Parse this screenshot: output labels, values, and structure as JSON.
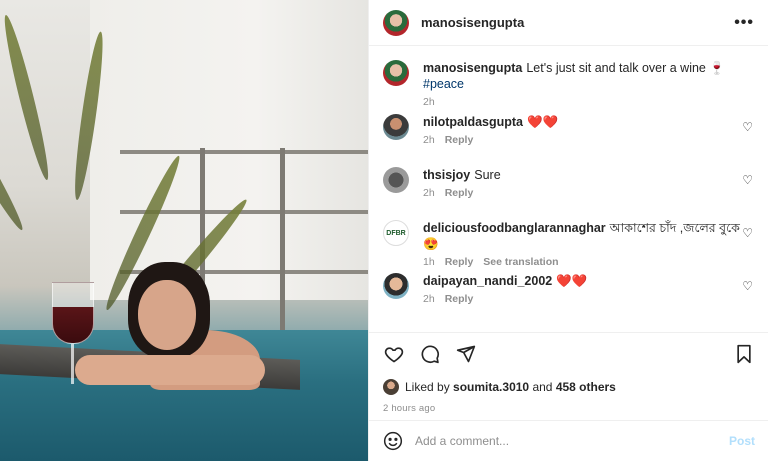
{
  "post": {
    "username": "manosisengupta",
    "more_icon": "more-horizontal-icon"
  },
  "caption": {
    "username": "manosisengupta",
    "text": "Let's just sit and talk over a wine 🍷",
    "hashtag": "#peace",
    "time": "2h"
  },
  "comments": [
    {
      "username": "nilotpaldasgupta",
      "text": "❤️❤️",
      "time": "2h",
      "reply": "Reply",
      "translation": ""
    },
    {
      "username": "thsisjoy",
      "text": "Sure",
      "time": "2h",
      "reply": "Reply",
      "translation": ""
    },
    {
      "username": "deliciousfoodbanglarannaghar",
      "text": "আকাশের চাঁদ ,জলের বুকে 😍",
      "time": "1h",
      "reply": "Reply",
      "translation": "See translation",
      "avatar_text": "DFBR"
    },
    {
      "username": "daipayan_nandi_2002",
      "text": "❤️❤️",
      "time": "2h",
      "reply": "Reply",
      "translation": ""
    }
  ],
  "likes": {
    "prefix": "Liked by",
    "user": "soumita.3010",
    "conjunction": "and",
    "others": "458 others"
  },
  "posted_ago": "2 hours ago",
  "composer": {
    "placeholder": "Add a comment...",
    "post_label": "Post"
  },
  "colors": {
    "heart_red": "#ed4956",
    "link_blue": "#00376b",
    "post_disabled": "#b2dffc",
    "muted": "#8e8e8e"
  }
}
